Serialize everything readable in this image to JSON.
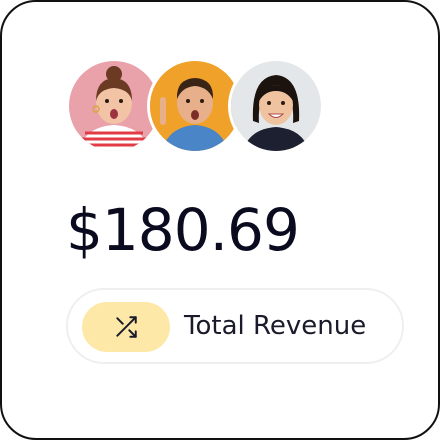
{
  "card": {
    "avatars": [
      {
        "name": "avatar-1",
        "background": "#e9a1aa",
        "shirt": "#e23b45",
        "hair": "#6a3a22"
      },
      {
        "name": "avatar-2",
        "background": "#f0a12a",
        "shirt": "#4a86c7",
        "hair": "#3a2416"
      },
      {
        "name": "avatar-3",
        "background": "#e4e7ea",
        "shirt": "#1d2030",
        "hair": "#1c130e"
      }
    ],
    "amount": "$180.69",
    "metric": {
      "icon": "shuffle-icon",
      "label": "Total Revenue",
      "icon_background": "#fde8a8"
    }
  }
}
